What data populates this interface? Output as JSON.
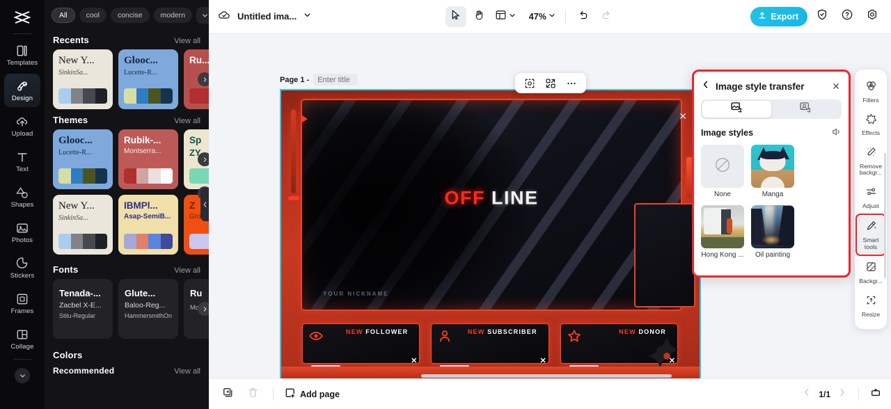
{
  "app": {
    "brand_icon": "capcut-logo-icon",
    "accent": "#15b8e8",
    "highlight_red": "#f0242d",
    "selection_cyan": "#2ec5f0"
  },
  "left_rail": {
    "items": [
      {
        "label": "Templates",
        "icon": "templates-icon",
        "active": false
      },
      {
        "label": "Design",
        "icon": "design-icon",
        "active": true
      },
      {
        "label": "Upload",
        "icon": "upload-icon",
        "active": false
      },
      {
        "label": "Text",
        "icon": "text-icon",
        "active": false
      },
      {
        "label": "Shapes",
        "icon": "shapes-icon",
        "active": false
      },
      {
        "label": "Photos",
        "icon": "photos-icon",
        "active": false
      },
      {
        "label": "Stickers",
        "icon": "stickers-icon",
        "active": false
      },
      {
        "label": "Frames",
        "icon": "frames-icon",
        "active": false
      },
      {
        "label": "Collage",
        "icon": "collage-icon",
        "active": false
      }
    ],
    "expand_icon": "chevron-down-icon"
  },
  "left_panel": {
    "filter_chips": [
      {
        "label": "All",
        "active": true
      },
      {
        "label": "cool",
        "active": false
      },
      {
        "label": "concise",
        "active": false
      },
      {
        "label": "modern",
        "active": false
      }
    ],
    "chip_more_icon": "chevron-down-icon",
    "sections": [
      {
        "title": "Recents",
        "view_all": "View all",
        "cards": [
          {
            "title": "New Y...",
            "subtitle": "SinkinSa...",
            "bg": "#ebe6dc",
            "title_color": "#1a1a1a",
            "sub_color": "#4a4a4a",
            "serif": true,
            "swatches": [
              "#a9cdf0",
              "#808388",
              "#46494e",
              "#1f2125"
            ]
          },
          {
            "title": "Glooc...",
            "subtitle": "Lucette-R...",
            "bg": "#7fa9dd",
            "title_color": "#12263f",
            "sub_color": "#16304f",
            "serif": true,
            "swatches": [
              "#d5dfa3",
              "#2f7bc4",
              "#49561f",
              "#12344d"
            ]
          },
          {
            "title": "Ru...",
            "subtitle": "",
            "bg": "#b6504f",
            "title_color": "#ffffff",
            "sub_color": "#ffffff",
            "serif": false,
            "swatches": [
              "#b0302f",
              "#b0302f",
              "#b0302f",
              "#b0302f"
            ]
          }
        ]
      },
      {
        "title": "Themes",
        "view_all": "View all",
        "cards_row1": [
          {
            "title": "Glooc...",
            "subtitle": "Lucette-R...",
            "bg": "#7fa9dd",
            "title_color": "#12263f",
            "sub_color": "#16304f",
            "serif": true,
            "swatches": [
              "#d5dfa3",
              "#2f7bc4",
              "#49561f",
              "#12344d"
            ]
          },
          {
            "title": "Rubik-...",
            "subtitle": "Montserra...",
            "bg": "#bd5a58",
            "title_color": "#ffffff",
            "sub_color": "#f6eaea",
            "serif": false,
            "swatches": [
              "#b0302f",
              "#cfa5a4",
              "#ecdfdf",
              "#ffffff"
            ]
          },
          {
            "title": "Sp",
            "subtitle": "ZY",
            "bg": "#ece5cf",
            "title_color": "#14543f",
            "sub_color": "#14543f",
            "serif": false,
            "swatches": [
              "#79d8b3",
              "#79d8b3",
              "#79d8b3",
              "#79d8b3"
            ]
          }
        ],
        "cards_row2": [
          {
            "title": "New Y...",
            "subtitle": "SinkinSa...",
            "bg": "#ebe6dc",
            "title_color": "#1a1a1a",
            "sub_color": "#4a4a4a",
            "serif": true,
            "swatches": [
              "#a9cdf0",
              "#808388",
              "#46494e",
              "#1f2125"
            ]
          },
          {
            "title": "IBMPl...",
            "subtitle": "Asap-SemiB...",
            "bg": "#f0dfa9",
            "title_color": "#2b2f8c",
            "sub_color": "#2b2f8c",
            "serif": false,
            "swatches": [
              "#a7a8d8",
              "#e0806e",
              "#5b84dd",
              "#3f4a9e"
            ]
          },
          {
            "title": "Z",
            "subtitle": "Gro",
            "bg": "#ef4f10",
            "title_color": "#7a1f06",
            "sub_color": "#7a1f06",
            "serif": false,
            "swatches": [
              "#c9c7ef",
              "#c9c7ef",
              "#c9c7ef",
              "#c9c7ef"
            ]
          }
        ]
      },
      {
        "title": "Fonts",
        "view_all": "View all",
        "cards": [
          {
            "line1": "Tenada-...",
            "line2": "Zacbel X-E...",
            "line3": "Stilu-Regular"
          },
          {
            "line1": "Glute...",
            "line2": "Baloo-Reg...",
            "line3": "HammersmithOn..."
          },
          {
            "line1": "Ru",
            "line2": "",
            "line3": "Mor"
          }
        ]
      },
      {
        "title": "Colors",
        "subtitle": "Recommended",
        "view_all": "View all"
      }
    ],
    "carousel_next_icon": "chevron-right-icon",
    "collapse_icon": "chevron-left-icon"
  },
  "topbar": {
    "cloud_icon": "cloud-saved-icon",
    "doc_title": "Untitled ima...",
    "doc_dropdown_icon": "chevron-down-icon",
    "tools": [
      {
        "name": "select-tool",
        "icon": "cursor-icon",
        "selected": true
      },
      {
        "name": "hand-tool",
        "icon": "hand-icon",
        "selected": false
      },
      {
        "name": "layout-tool",
        "icon": "layout-icon",
        "selected": false
      }
    ],
    "layout_dropdown_icon": "chevron-down-icon",
    "zoom_value": "47%",
    "zoom_dropdown_icon": "chevron-down-icon",
    "undo_icon": "undo-icon",
    "redo_icon": "redo-icon",
    "export_label": "Export",
    "export_icon": "export-upload-icon",
    "shield_icon": "shield-check-icon",
    "help_icon": "question-circle-icon",
    "settings_icon": "gear-icon"
  },
  "canvas": {
    "page_label": "Page 1 -",
    "title_placeholder": "Enter title",
    "title_value": "",
    "float_tools": [
      {
        "name": "crop-tool",
        "icon": "crop-select-icon"
      },
      {
        "name": "replace-tool",
        "icon": "swap-icon"
      },
      {
        "name": "more-tool",
        "icon": "more-horizontal-icon"
      }
    ],
    "artwork": {
      "headline_red": "OFF",
      "headline_white": "LINE",
      "nickname_text": "YOUR NICKNAME",
      "alerts": [
        {
          "prefix": "NEW",
          "label": "FOLLOWER",
          "icon": "eye-icon"
        },
        {
          "prefix": "NEW",
          "label": "SUBSCRIBER",
          "icon": "person-icon"
        },
        {
          "prefix": "NEW",
          "label": "DONOR",
          "icon": "star-icon"
        }
      ]
    }
  },
  "property_panel": {
    "back_icon": "chevron-left-icon",
    "title": "Image style transfer",
    "close_icon": "close-icon",
    "tabs": [
      {
        "name": "image-to-image-tab",
        "icon": "image-style-icon",
        "active": true
      },
      {
        "name": "portrait-style-tab",
        "icon": "portrait-style-icon",
        "active": false
      }
    ],
    "section_title": "Image styles",
    "feedback_icon": "speaker-icon",
    "styles": [
      {
        "name": "None",
        "kind": "none",
        "selected": false
      },
      {
        "name": "Manga",
        "kind": "cat",
        "selected": false
      },
      {
        "name": "Hong Kong ...",
        "kind": "hongkong",
        "selected": true
      },
      {
        "name": "Oil painting",
        "kind": "oil",
        "selected": false
      }
    ]
  },
  "right_rail": {
    "items": [
      {
        "label": "Filters",
        "icon": "filters-icon",
        "active": false
      },
      {
        "label": "Effects",
        "icon": "effects-icon",
        "active": false
      },
      {
        "label": "Remove backgr...",
        "icon": "remove-background-icon",
        "active": false
      },
      {
        "label": "Adjust",
        "icon": "adjust-sliders-icon",
        "active": false
      },
      {
        "label": "Smart tools",
        "icon": "magic-wand-icon",
        "active": true
      },
      {
        "label": "Backgr...",
        "icon": "background-icon",
        "active": false
      },
      {
        "label": "Resize",
        "icon": "resize-icon",
        "active": false
      }
    ]
  },
  "bottombar": {
    "duplicate_icon": "duplicate-page-icon",
    "delete_icon": "trash-icon",
    "add_page_label": "Add page",
    "add_page_icon": "add-page-icon",
    "prev_icon": "chevron-left-icon",
    "page_indicator": "1/1",
    "next_icon": "chevron-right-icon",
    "grid_view_icon": "page-grid-icon"
  }
}
